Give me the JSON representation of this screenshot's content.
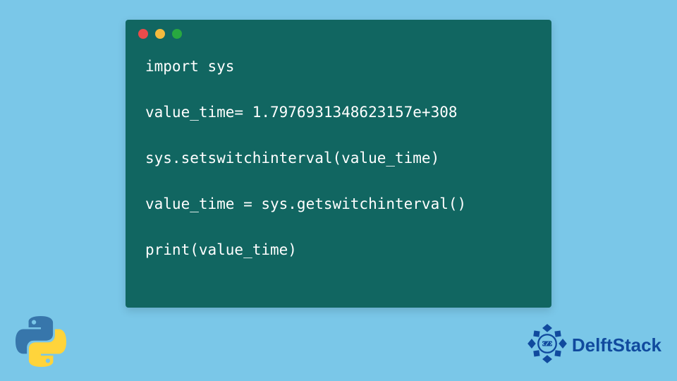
{
  "code_window": {
    "lines": [
      "import sys",
      "",
      "value_time= 1.7976931348623157e+308",
      "",
      "sys.setswitchinterval(value_time)",
      "",
      "value_time = sys.getswitchinterval()",
      "",
      "print(value_time)"
    ]
  },
  "brand": {
    "name": "DelftStack"
  },
  "colors": {
    "page_bg": "#7ac7e8",
    "window_bg": "#116661",
    "code_fg": "#ffffff",
    "brand_fg": "#104a9e",
    "dot_red": "#e94b4b",
    "dot_yellow": "#f4ba3e",
    "dot_green": "#28a840"
  }
}
